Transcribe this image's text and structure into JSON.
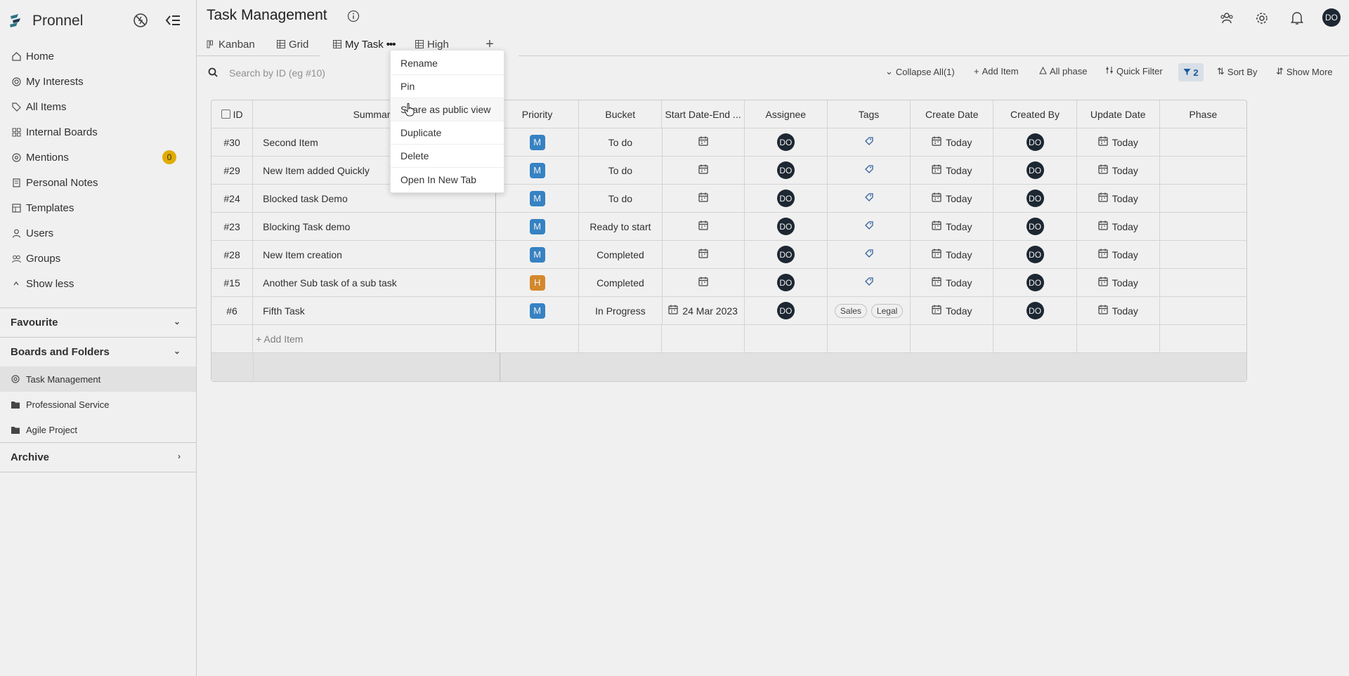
{
  "colors": {
    "accent": "#1d5fa7",
    "badge": "#f0b700",
    "priority_m": "#3a8bd0",
    "priority_h": "#e2912f",
    "avatar": "#1f2a36"
  },
  "sidebar": {
    "brand": "Pronnel",
    "nav": [
      {
        "label": "Home",
        "icon": "home-icon"
      },
      {
        "label": "My Interests",
        "icon": "target-icon"
      },
      {
        "label": "All Items",
        "icon": "tag-icon"
      },
      {
        "label": "Internal Boards",
        "icon": "boards-icon"
      },
      {
        "label": "Mentions",
        "icon": "at-icon",
        "badge": "0"
      },
      {
        "label": "Personal Notes",
        "icon": "notes-icon"
      },
      {
        "label": "Templates",
        "icon": "template-icon"
      },
      {
        "label": "Users",
        "icon": "user-icon"
      },
      {
        "label": "Groups",
        "icon": "groups-icon"
      },
      {
        "label": "Show less",
        "icon": "chevron-up-icon"
      }
    ],
    "favourite": "Favourite",
    "boards_and_folders": "Boards and Folders",
    "folders": [
      {
        "label": "Task Management",
        "icon": "board-target-icon"
      },
      {
        "label": "Professional Service",
        "icon": "folder-icon"
      },
      {
        "label": "Agile Project",
        "icon": "folder-icon"
      }
    ],
    "archive": "Archive"
  },
  "header": {
    "title": "Task Management"
  },
  "tabs": [
    {
      "label": "Kanban",
      "icon": "kanban-icon"
    },
    {
      "label": "Grid",
      "icon": "grid-icon"
    },
    {
      "label": "My Task",
      "icon": "grid-icon",
      "menu": "•••"
    },
    {
      "label": "High",
      "icon": "grid-icon"
    }
  ],
  "toolbar": {
    "search_placeholder": "Search by ID (eg #10)",
    "collapse_all": "Collapse All(1)",
    "add_item": "Add Item",
    "all_phase": "All phase",
    "quick_filter": "Quick Filter",
    "filter_count": "2",
    "sort_by": "Sort By",
    "show_more": "Show More"
  },
  "table": {
    "columns": [
      "ID",
      "Summary",
      "Priority",
      "Bucket",
      "Start Date-End ...",
      "Assignee",
      "Tags",
      "Create Date",
      "Created By",
      "Update Date",
      "Phase"
    ],
    "rows": [
      {
        "id": "#30",
        "summary": "Second Item",
        "priority": "M",
        "bucket": "To do",
        "date": "",
        "assignee": "DO",
        "tags": [],
        "create_date": "Today",
        "created_by": "DO",
        "update_date": "Today"
      },
      {
        "id": "#29",
        "summary": "New Item added Quickly",
        "priority": "M",
        "bucket": "To do",
        "date": "",
        "assignee": "DO",
        "tags": [],
        "create_date": "Today",
        "created_by": "DO",
        "update_date": "Today"
      },
      {
        "id": "#24",
        "summary": "Blocked task Demo",
        "priority": "M",
        "bucket": "To do",
        "date": "",
        "assignee": "DO",
        "tags": [],
        "create_date": "Today",
        "created_by": "DO",
        "update_date": "Today"
      },
      {
        "id": "#23",
        "summary": "Blocking Task demo",
        "priority": "M",
        "bucket": "Ready to start",
        "date": "",
        "assignee": "DO",
        "tags": [],
        "create_date": "Today",
        "created_by": "DO",
        "update_date": "Today"
      },
      {
        "id": "#28",
        "summary": "New Item creation",
        "priority": "M",
        "bucket": "Completed",
        "date": "",
        "assignee": "DO",
        "tags": [],
        "create_date": "Today",
        "created_by": "DO",
        "update_date": "Today"
      },
      {
        "id": "#15",
        "summary": "Another Sub task of a sub task",
        "priority": "H",
        "bucket": "Completed",
        "date": "",
        "assignee": "DO",
        "tags": [],
        "create_date": "Today",
        "created_by": "DO",
        "update_date": "Today"
      },
      {
        "id": "#6",
        "summary": "Fifth Task",
        "priority": "M",
        "bucket": "In Progress",
        "date": "24 Mar 2023",
        "assignee": "DO",
        "tags": [
          "Sales",
          "Legal"
        ],
        "create_date": "Today",
        "created_by": "DO",
        "update_date": "Today"
      }
    ],
    "add_item": "+ Add Item"
  },
  "context_menu": [
    "Rename",
    "Pin",
    "Share as public view",
    "Duplicate",
    "Delete",
    "Open In New Tab"
  ],
  "user": {
    "initials": "DO"
  }
}
